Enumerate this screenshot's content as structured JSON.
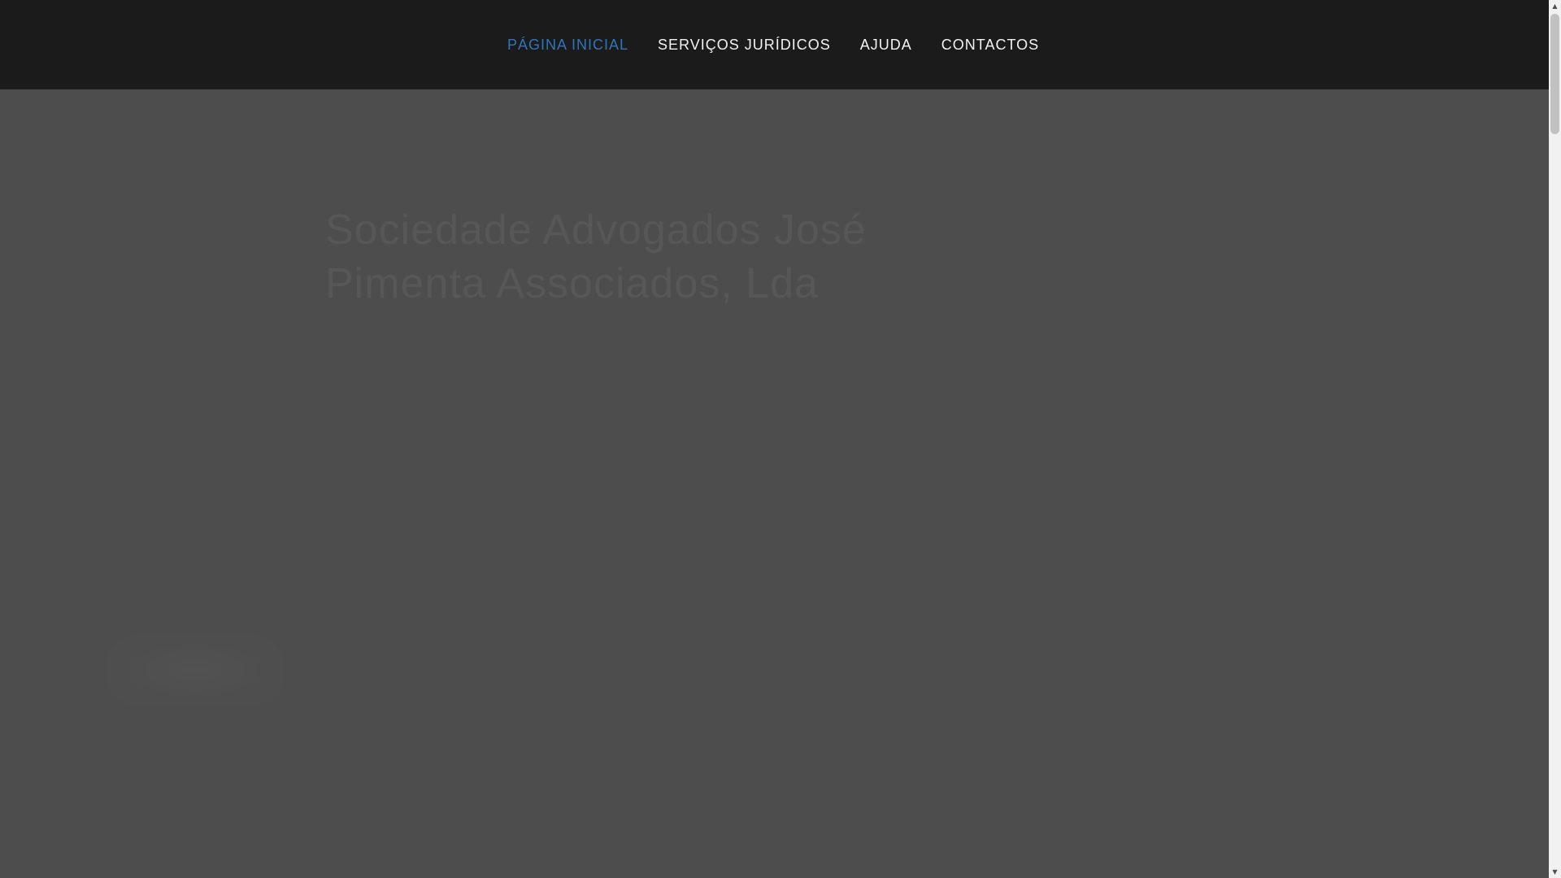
{
  "nav": {
    "items": [
      {
        "label": "PÁGINA INICIAL",
        "active": true
      },
      {
        "label": "SERVIÇOS JURÍDICOS",
        "active": false
      },
      {
        "label": "AJUDA",
        "active": false
      },
      {
        "label": "CONTACTOS",
        "active": false
      }
    ]
  },
  "hero": {
    "title": "Sociedade Advogados José Pimenta Associados, Lda"
  },
  "colors": {
    "nav_background": "#1b1b1b",
    "page_background": "#4d4d4d",
    "active_link": "#2f76b9",
    "link": "#f2f2f2"
  },
  "icons": {
    "scroll_up": "▲",
    "scroll_down": "▼"
  }
}
